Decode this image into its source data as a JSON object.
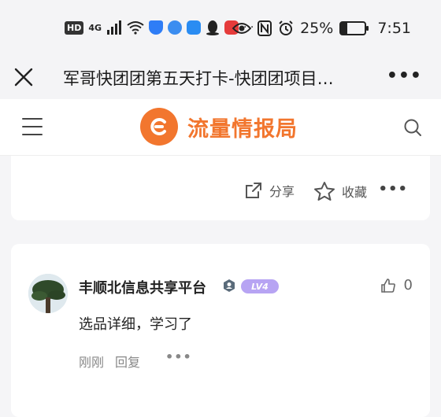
{
  "status_bar": {
    "network": "4G",
    "battery_percent": "25%",
    "battery_level": 0.25,
    "time": "7:51",
    "overflow": "···"
  },
  "title_bar": {
    "title": "军哥快团团第五天打卡-快团团项目…",
    "more": "•••"
  },
  "site_header": {
    "logo_text": "流量情报局"
  },
  "post_actions": {
    "share_label": "分享",
    "favorite_label": "收藏",
    "more": "•••"
  },
  "comment": {
    "user_name": "丰顺北信息共享平台",
    "level_badge": "LV4",
    "like_count": "0",
    "text": "选品详细，学习了",
    "time": "刚刚",
    "reply_label": "回复",
    "more": "•••"
  },
  "colors": {
    "brand": "#f2762e",
    "level_badge": "#b7a4f3"
  }
}
